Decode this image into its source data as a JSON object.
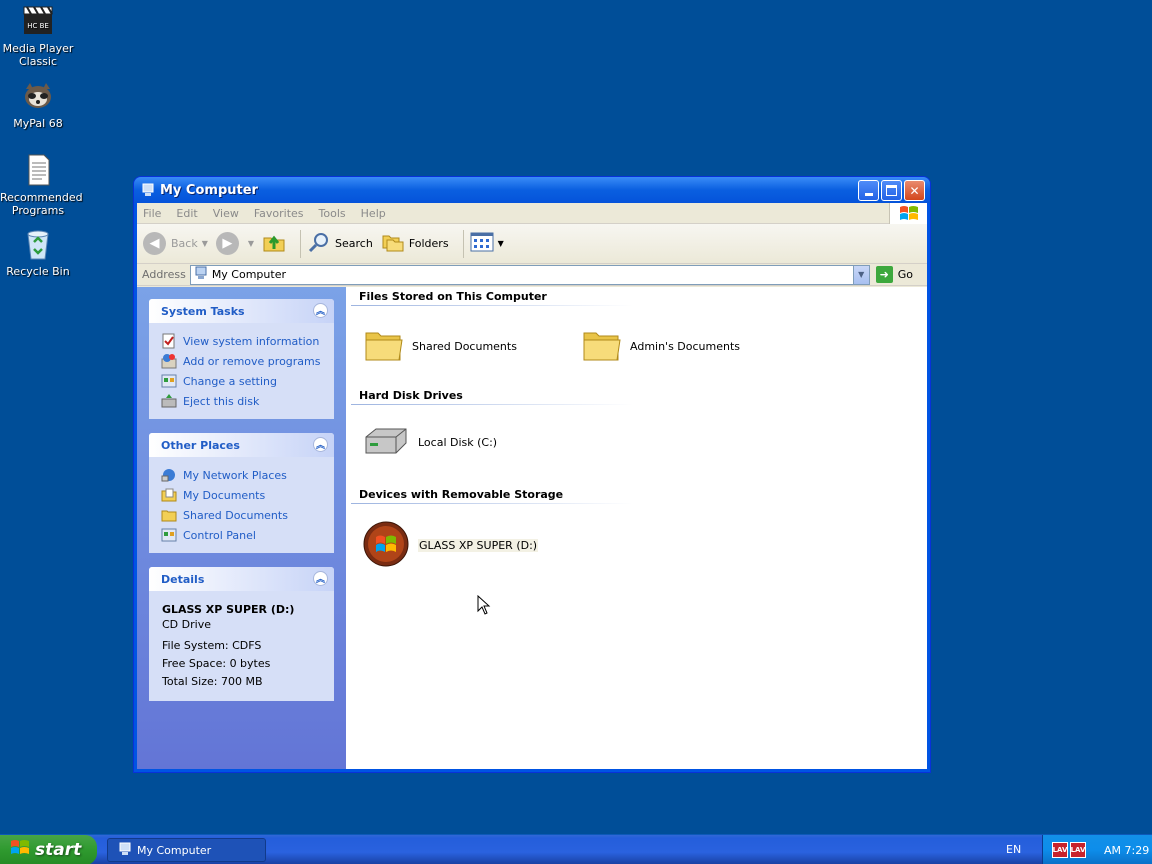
{
  "desktop": {
    "icons": [
      {
        "label": "Media Player Classic"
      },
      {
        "label": "MyPal 68"
      },
      {
        "label": "Recommended Programs"
      },
      {
        "label": "Recycle Bin"
      }
    ]
  },
  "window": {
    "title": "My Computer",
    "menu": [
      "File",
      "Edit",
      "View",
      "Favorites",
      "Tools",
      "Help"
    ],
    "toolbar": {
      "back": "Back",
      "search": "Search",
      "folders": "Folders"
    },
    "address": {
      "label": "Address",
      "value": "My Computer",
      "go": "Go"
    },
    "sidebar": {
      "system_tasks": {
        "title": "System Tasks",
        "items": [
          "View system information",
          "Add or remove programs",
          "Change a setting",
          "Eject this disk"
        ]
      },
      "other_places": {
        "title": "Other Places",
        "items": [
          "My Network Places",
          "My Documents",
          "Shared Documents",
          "Control Panel"
        ]
      },
      "details": {
        "title": "Details",
        "name": "GLASS XP SUPER (D:)",
        "type": "CD Drive",
        "file_system": "File System: CDFS",
        "free_space": "Free Space: 0 bytes",
        "total_size": "Total Size: 700 MB"
      }
    },
    "groups": {
      "files_stored": {
        "title": "Files Stored on This Computer",
        "items": [
          "Shared Documents",
          "Admin's Documents"
        ]
      },
      "hard_disks": {
        "title": "Hard Disk Drives",
        "items": [
          "Local Disk (C:)"
        ]
      },
      "removable": {
        "title": "Devices with Removable Storage",
        "items": [
          "GLASS XP SUPER (D:)"
        ]
      }
    }
  },
  "taskbar": {
    "start": "start",
    "task": "My Computer",
    "language": "EN",
    "clock": "AM 7:29",
    "tray_icon": "LAV"
  },
  "colors": {
    "desktop": "#004e98",
    "link": "#215dc6",
    "titlebar": "#0a5fe0"
  }
}
